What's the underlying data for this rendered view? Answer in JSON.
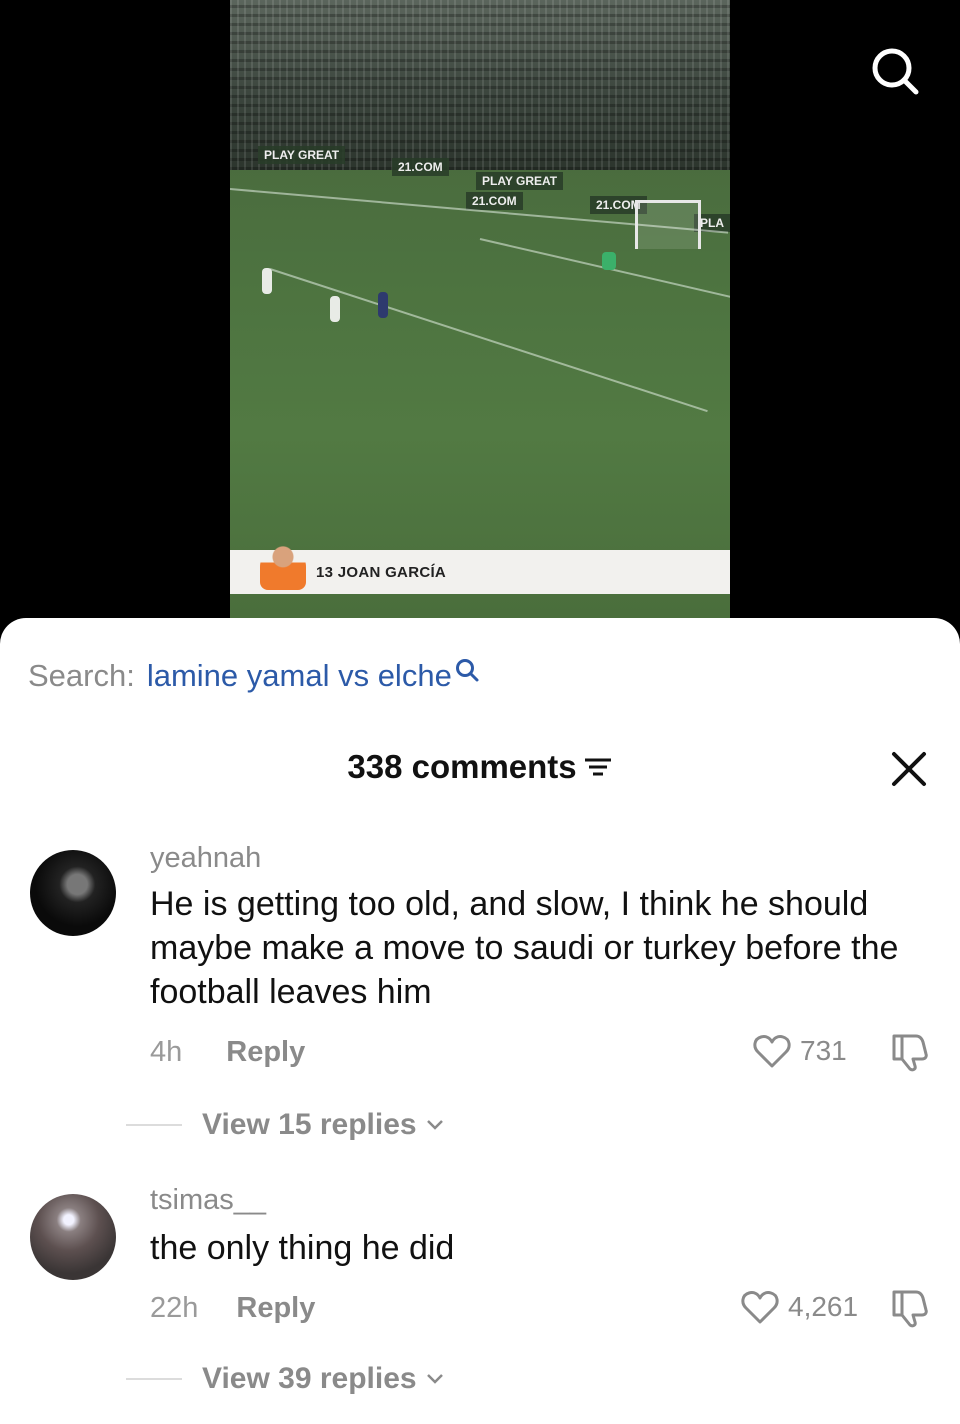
{
  "video": {
    "boards": [
      "PLAY GREAT",
      "21.COM",
      "PLAY GREAT",
      "21.COM",
      "21.COM",
      "PLA"
    ],
    "lower_third": "13 JOAN GARCÍA"
  },
  "search": {
    "label": "Search:",
    "term": "lamine yamal vs elche"
  },
  "comments_panel": {
    "title": "338 comments"
  },
  "comments": [
    {
      "username": "yeahnah",
      "text": "He is getting too old, and slow, I think he should maybe make a move to saudi or turkey before the football leaves him",
      "time": "4h",
      "reply_label": "Reply",
      "likes": "731",
      "view_replies": "View 15 replies"
    },
    {
      "username": "tsimas__",
      "text": "the only thing he did",
      "time": "22h",
      "reply_label": "Reply",
      "likes": "4,261",
      "view_replies": "View 39 replies"
    }
  ],
  "colors": {
    "search_term": "#2c5aa8",
    "muted_text": "#8a8a8a",
    "sheet_background": "#ffffff"
  }
}
